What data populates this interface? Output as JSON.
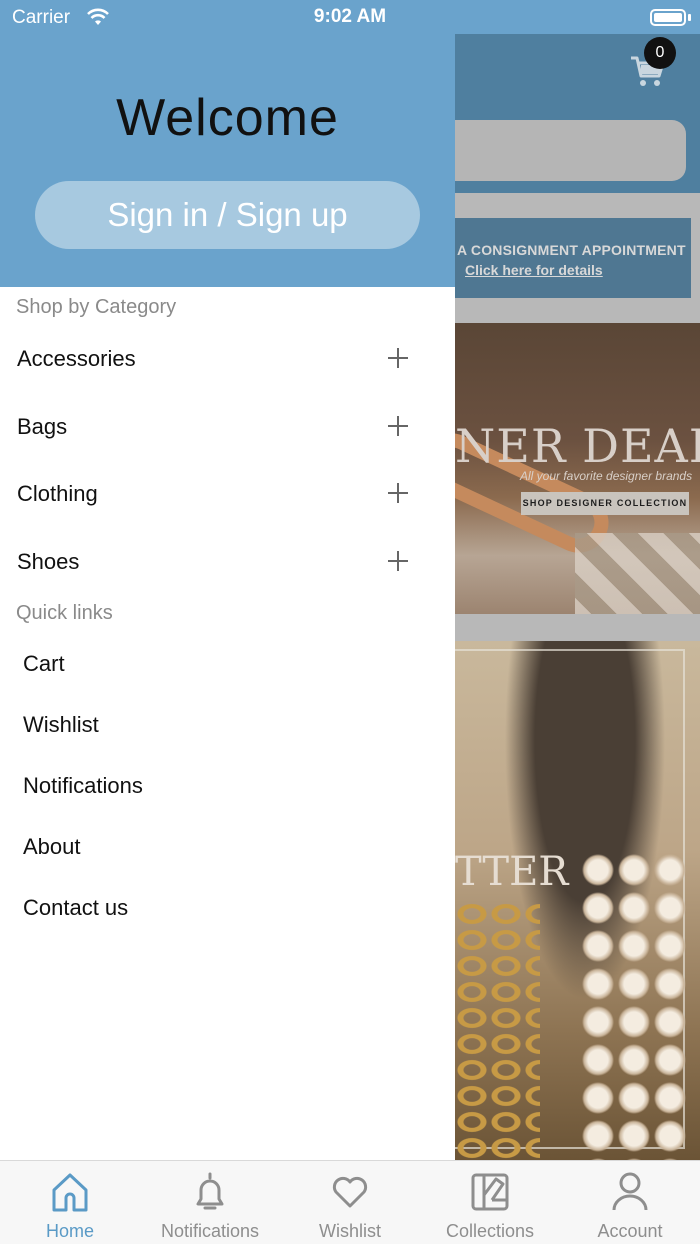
{
  "status_bar": {
    "carrier": "Carrier",
    "time": "9:02 AM"
  },
  "background": {
    "cart_count": "0",
    "promo_line1": "A CONSIGNMENT APPOINTMENT",
    "promo_line2": "Click here for details",
    "deals_title": "NER DEALS",
    "deals_subtitle": "All your favorite designer brands",
    "deals_button": "SHOP DESIGNER COLLECTION",
    "glitter_title": "TTER"
  },
  "drawer": {
    "welcome": "Welcome",
    "signin_label": "Sign in / Sign up",
    "category_header": "Shop by Category",
    "categories": [
      {
        "label": "Accessories"
      },
      {
        "label": "Bags"
      },
      {
        "label": "Clothing"
      },
      {
        "label": "Shoes"
      }
    ],
    "quick_links_header": "Quick links",
    "quick_links": [
      {
        "label": "Cart"
      },
      {
        "label": "Wishlist"
      },
      {
        "label": "Notifications"
      },
      {
        "label": "About"
      },
      {
        "label": "Contact us"
      }
    ]
  },
  "tab_bar": {
    "tabs": [
      {
        "label": "Home",
        "icon": "home-icon",
        "active": true
      },
      {
        "label": "Notifications",
        "icon": "bell-icon",
        "active": false
      },
      {
        "label": "Wishlist",
        "icon": "heart-icon",
        "active": false
      },
      {
        "label": "Collections",
        "icon": "collections-icon",
        "active": false
      },
      {
        "label": "Account",
        "icon": "person-icon",
        "active": false
      }
    ]
  },
  "colors": {
    "accent": "#6aa3cc",
    "active_tab": "#5a9ac6",
    "inactive_tab": "#8e8e8e"
  }
}
